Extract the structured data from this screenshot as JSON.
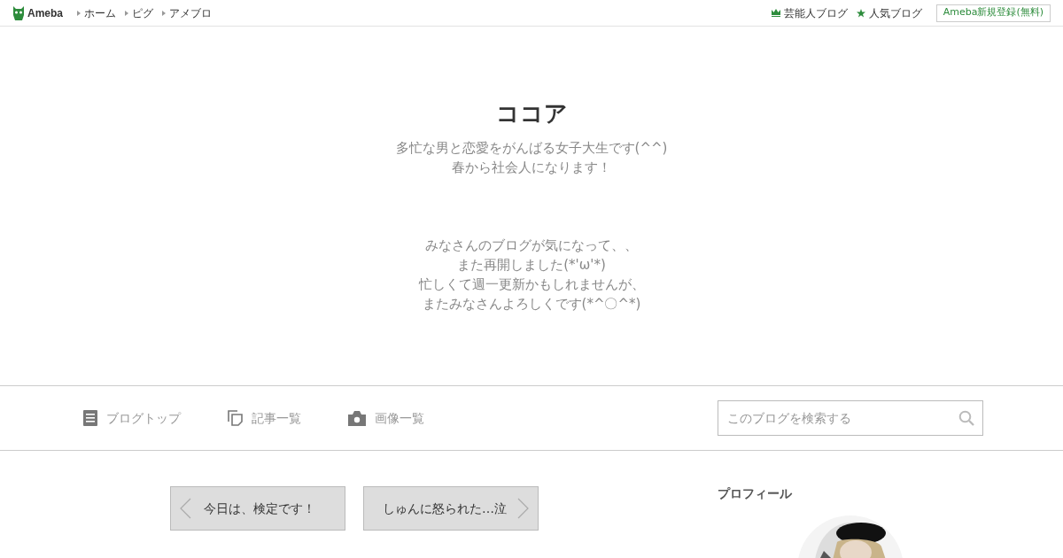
{
  "header": {
    "logo": "Ameba",
    "links": [
      "ホーム",
      "ピグ",
      "アメブロ"
    ],
    "right_links": [
      {
        "kind": "crown",
        "label": "芸能人ブログ"
      },
      {
        "kind": "star",
        "label": "人気ブログ"
      }
    ],
    "signup": "Ameba新規登録(無料)"
  },
  "blog": {
    "title": "ココア",
    "intro_lines": [
      "多忙な男と恋愛をがんばる女子大生です(^^)",
      "春から社会人になります！"
    ],
    "message_lines": [
      "みなさんのブログが気になって、、",
      "また再開しました(*'ω'*)",
      "忙しくて週一更新かもしれませんが、",
      "またみなさんよろしくです(*^〇^*)"
    ]
  },
  "nav": {
    "items": [
      {
        "kind": "doc",
        "label": "ブログトップ"
      },
      {
        "kind": "copy",
        "label": "記事一覧"
      },
      {
        "kind": "camera",
        "label": "画像一覧"
      }
    ],
    "search": {
      "placeholder": "このブログを検索する"
    }
  },
  "pager": [
    {
      "kind": "prev",
      "label": "今日は、検定です！"
    },
    {
      "kind": "next",
      "label": "しゅんに怒られた…泣"
    }
  ],
  "sidebar": {
    "heading": "プロフィール"
  }
}
